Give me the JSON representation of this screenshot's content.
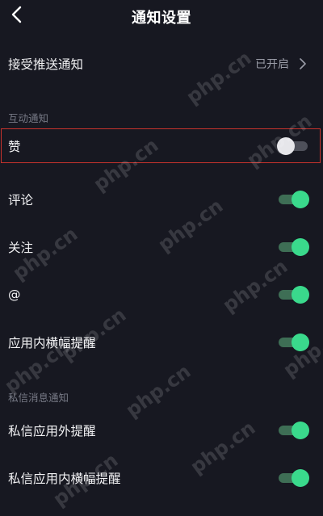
{
  "header": {
    "title": "通知设置",
    "back_icon": "chevron-left-icon"
  },
  "push": {
    "label": "接受推送通知",
    "value": "已开启",
    "arrow_icon": "chevron-right-icon"
  },
  "sections": {
    "interaction": "互动通知",
    "private_message": "私信消息通知"
  },
  "items": {
    "like": {
      "label": "赞",
      "enabled": false
    },
    "comment": {
      "label": "评论",
      "enabled": true
    },
    "follow": {
      "label": "关注",
      "enabled": true
    },
    "mention": {
      "label": "@",
      "enabled": true
    },
    "in_app_banner": {
      "label": "应用内横幅提醒",
      "enabled": true
    },
    "dm_outside_app": {
      "label": "私信应用外提醒",
      "enabled": true
    },
    "dm_in_app_banner": {
      "label": "私信应用内横幅提醒",
      "enabled": true
    }
  },
  "watermark": "php.cn",
  "colors": {
    "background": "#171821",
    "toggle_on": "#3ad98c",
    "toggle_off": "#e6e6ea",
    "highlight": "#c8332d"
  }
}
